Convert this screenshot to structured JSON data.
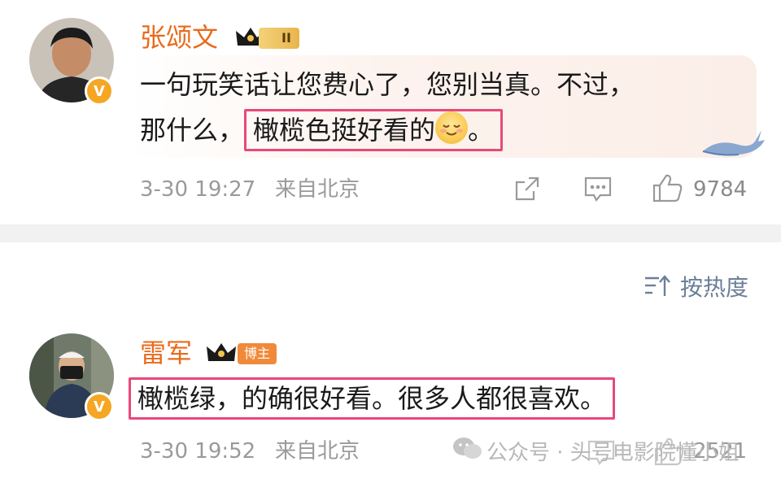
{
  "comment1": {
    "author": "张颂文",
    "level_badge": "II",
    "verified_mark": "V",
    "line1": "一句玩笑话让您费心了，您别当真。不过，",
    "line2_prefix": "那什么，",
    "highlight": "橄榄色挺好看的",
    "emoji_name": "smile-emoji",
    "line2_suffix": "。",
    "time": "3-30 19:27",
    "location": "来自北京",
    "likes": "9784"
  },
  "sort": {
    "label": "按热度"
  },
  "comment2": {
    "author": "雷军",
    "role_badge": "博主",
    "verified_mark": "V",
    "highlight": "橄榄绿，的确很好看。很多人都很喜欢。",
    "time": "3-30 19:52",
    "location": "来自北京",
    "likes": "2521"
  },
  "watermark": {
    "text": "公众号 · 头号电影院懂小姐"
  },
  "colors": {
    "author_name": "#e86b1c",
    "highlight_border": "#e8497a",
    "meta_gray": "#9a9a9a",
    "sort_blue": "#6b7f99"
  },
  "icons": [
    "share-icon",
    "comment-icon",
    "like-icon",
    "sort-icon",
    "wechat-icon",
    "whale-icon",
    "crown-icon"
  ]
}
